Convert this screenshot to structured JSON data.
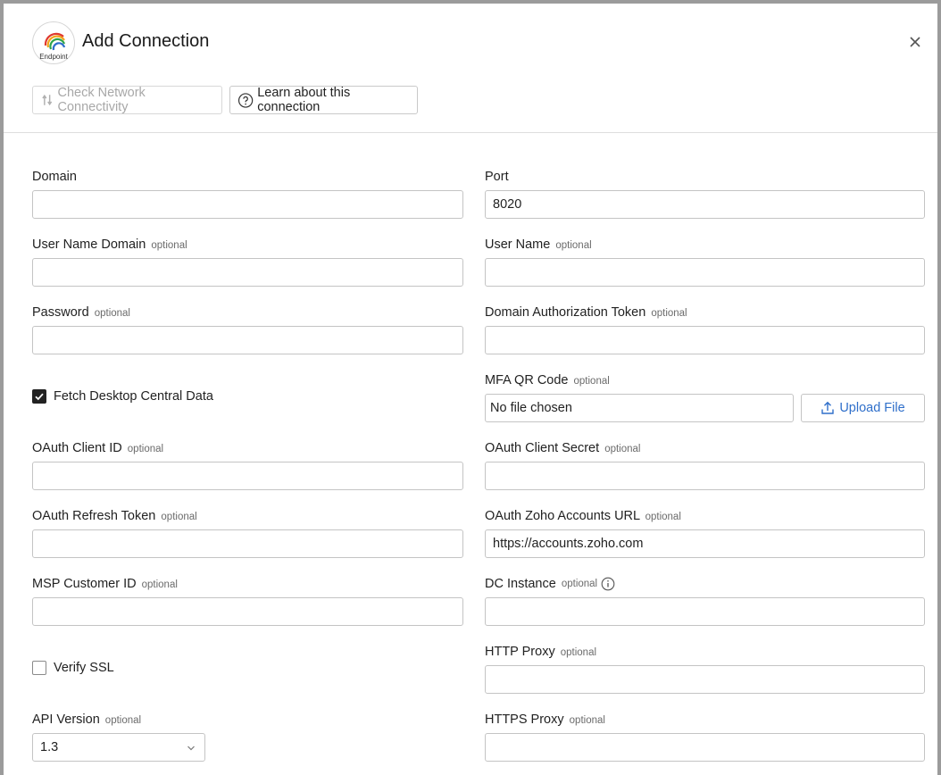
{
  "header": {
    "logo_text": "Endpoint",
    "title": "Add Connection",
    "close_icon": "close-icon"
  },
  "toolbar": {
    "check_network_label": "Check Network Connectivity",
    "learn_label": "Learn about this connection"
  },
  "optional_tag": "optional",
  "fields": {
    "domain": {
      "label": "Domain",
      "value": ""
    },
    "port": {
      "label": "Port",
      "value": "8020"
    },
    "user_name_domain": {
      "label": "User Name Domain",
      "value": ""
    },
    "user_name": {
      "label": "User Name",
      "value": ""
    },
    "password": {
      "label": "Password",
      "value": ""
    },
    "domain_auth_token": {
      "label": "Domain Authorization Token",
      "value": ""
    },
    "fetch_desktop": {
      "label": "Fetch Desktop Central Data",
      "checked": true
    },
    "mfa_qr": {
      "label": "MFA QR Code",
      "file_status": "No file chosen",
      "upload_label": "Upload File"
    },
    "oauth_client_id": {
      "label": "OAuth Client ID",
      "value": ""
    },
    "oauth_client_secret": {
      "label": "OAuth Client Secret",
      "value": ""
    },
    "oauth_refresh_token": {
      "label": "OAuth Refresh Token",
      "value": ""
    },
    "oauth_zoho_url": {
      "label": "OAuth Zoho Accounts URL",
      "value": "https://accounts.zoho.com"
    },
    "msp_customer_id": {
      "label": "MSP Customer ID",
      "value": ""
    },
    "dc_instance": {
      "label": "DC Instance",
      "value": ""
    },
    "verify_ssl": {
      "label": "Verify SSL",
      "checked": false
    },
    "http_proxy": {
      "label": "HTTP Proxy",
      "value": ""
    },
    "api_version": {
      "label": "API Version",
      "value": "1.3"
    },
    "https_proxy": {
      "label": "HTTPS Proxy",
      "value": ""
    }
  },
  "colors": {
    "accent": "#2f6fca",
    "border": "#c4c4c4",
    "frame": "#9b9b9b"
  }
}
